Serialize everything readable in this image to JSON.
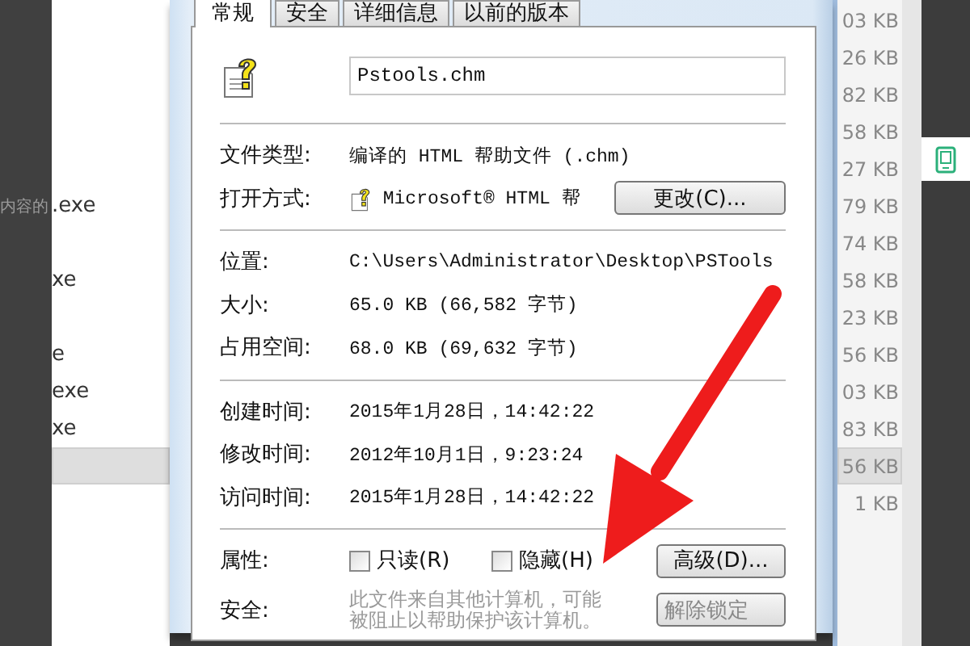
{
  "file_rows": [
    {
      "size": "03 KB",
      "selected": false
    },
    {
      "size": "26 KB",
      "selected": false
    },
    {
      "size": "82 KB",
      "selected": false
    },
    {
      "size": "58 KB",
      "selected": false
    },
    {
      "size": "27 KB",
      "selected": false
    },
    {
      "dimmed": "内容的",
      "name": ".exe",
      "size": "79 KB",
      "selected": false
    },
    {
      "size": "74 KB",
      "selected": false
    },
    {
      "name": "xe",
      "size": "58 KB",
      "selected": false
    },
    {
      "size": "23 KB",
      "selected": false
    },
    {
      "name": "e",
      "size": "56 KB",
      "selected": false
    },
    {
      "name": "exe",
      "size": "03 KB",
      "selected": false
    },
    {
      "name": "xe",
      "size": "83 KB",
      "selected": false
    },
    {
      "size": "56 KB",
      "selected": true
    },
    {
      "size": "1 KB",
      "selected": false
    }
  ],
  "dialog": {
    "tabs": [
      {
        "label": "常规",
        "selected": true
      },
      {
        "label": "安全",
        "selected": false
      },
      {
        "label": "详细信息",
        "selected": false
      },
      {
        "label": "以前的版本",
        "selected": false
      }
    ],
    "file_name": "Pstools.chm",
    "sections": [
      {
        "rows": [
          {
            "kind": "text",
            "label": "文件类型:",
            "value": "编译的 HTML 帮助文件 (.chm)"
          },
          {
            "kind": "app",
            "label": "打开方式:",
            "value": "Microsoft® HTML 帮",
            "button": "更改(C)..."
          }
        ]
      },
      {
        "rows": [
          {
            "kind": "text",
            "label": "位置:",
            "value": "C:\\Users\\Administrator\\Desktop\\PSTools"
          },
          {
            "kind": "text",
            "label": "大小:",
            "value": "65.0 KB (66,582 字节)"
          },
          {
            "kind": "text",
            "label": "占用空间:",
            "value": "68.0 KB (69,632 字节)"
          }
        ]
      },
      {
        "rows": [
          {
            "kind": "text",
            "label": "创建时间:",
            "value": "2015年1月28日，14:42:22"
          },
          {
            "kind": "text",
            "label": "修改时间:",
            "value": "2012年10月1日，9:23:24"
          },
          {
            "kind": "text",
            "label": "访问时间:",
            "value": "2015年1月28日，14:42:22"
          }
        ]
      },
      {
        "rows": [
          {
            "kind": "attributes",
            "label": "属性:",
            "checkboxes": [
              {
                "label": "只读(R)",
                "checked": false
              },
              {
                "label": "隐藏(H)",
                "checked": false
              }
            ],
            "button": "高级(D)..."
          },
          {
            "kind": "security",
            "label": "安全:",
            "value": "此文件来自其他计算机，可能被阻止以帮助保护该计算机。",
            "button": "解除锁定"
          }
        ]
      }
    ]
  }
}
